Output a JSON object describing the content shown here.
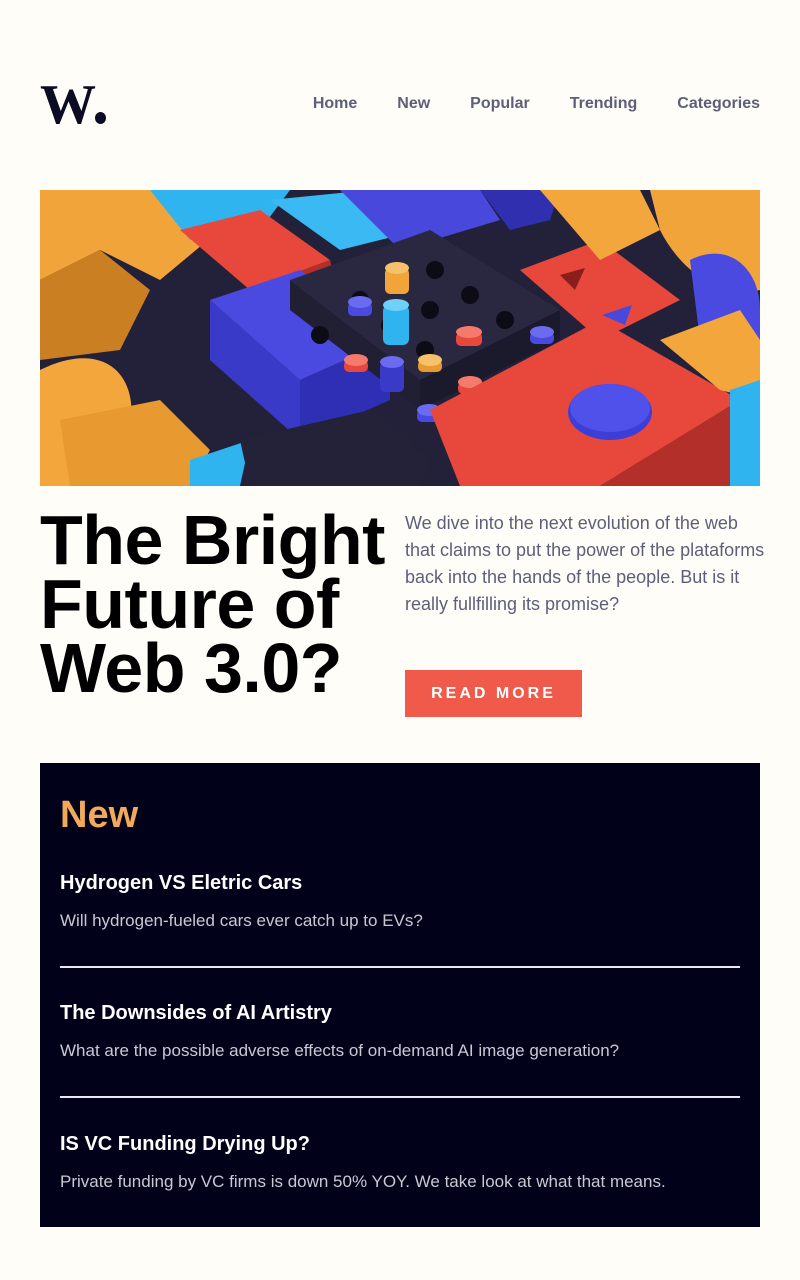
{
  "brand": {
    "logo_text": "W",
    "logo_icon": "w-dot-logo"
  },
  "nav": {
    "items": [
      {
        "label": "Home"
      },
      {
        "label": "New"
      },
      {
        "label": "Popular"
      },
      {
        "label": "Trending"
      },
      {
        "label": "Categories"
      }
    ]
  },
  "hero": {
    "image_icon": "colorful-3d-blocks-illustration",
    "headline": "The Bright Future of Web 3.0?",
    "summary": "We dive into the next evolution of the web that claims to put the power of the plataforms back into the hands of the people. But is it really fullfilling its promise?",
    "cta_label": "READ MORE"
  },
  "new_section": {
    "title": "New",
    "articles": [
      {
        "title": "Hydrogen VS Eletric Cars",
        "description": "Will hydrogen-fueled cars ever catch up to EVs?"
      },
      {
        "title": "The Downsides of AI Artistry",
        "description": "What are the possible adverse effects of on-demand AI image generation?"
      },
      {
        "title": "IS VC Funding Drying Up?",
        "description": "Private funding by VC firms is down 50% YOY. We take look at what that means."
      }
    ]
  },
  "colors": {
    "background": "#fffdf8",
    "accent": "#ef5a4b",
    "section_bg": "#02011a",
    "section_title": "#f3a95a",
    "nav_text": "#5d5f78"
  }
}
